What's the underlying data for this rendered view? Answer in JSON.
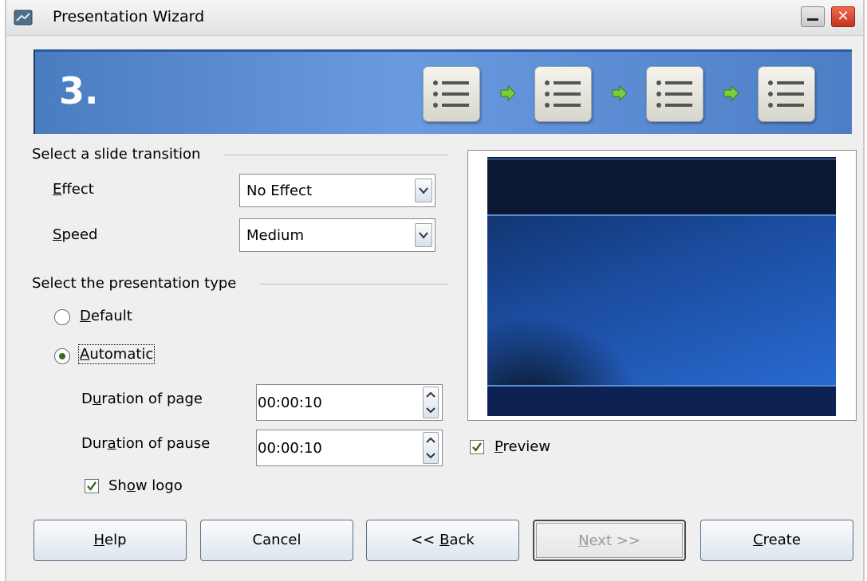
{
  "window": {
    "title": "Presentation Wizard",
    "close_glyph": "✕"
  },
  "banner": {
    "step": "3.",
    "accent_color": "#5b8fd6",
    "steps": [
      "list-icon",
      "list-icon",
      "list-icon",
      "list-icon"
    ]
  },
  "transition": {
    "section_label": "Select a slide transition",
    "effect": {
      "label_pre": "",
      "label_mnemonic": "E",
      "label_post": "ffect",
      "value": "No Effect"
    },
    "speed": {
      "label_pre": "",
      "label_mnemonic": "S",
      "label_post": "peed",
      "value": "Medium"
    }
  },
  "presentation_type": {
    "section_label": "Select the presentation type",
    "default": {
      "label_mnemonic": "D",
      "label_post": "efault",
      "selected": false
    },
    "automatic": {
      "label_mnemonic": "A",
      "label_post": "utomatic",
      "selected": true
    },
    "duration_page": {
      "label_pre": "D",
      "label_mnemonic": "u",
      "label_post": "ration of page",
      "value": "00:00:10"
    },
    "duration_pause": {
      "label_pre": "Dur",
      "label_mnemonic": "a",
      "label_post": "tion of pause",
      "value": "00:00:10"
    },
    "show_logo": {
      "label_pre": "Sh",
      "label_mnemonic": "o",
      "label_post": "w logo",
      "checked": true
    }
  },
  "preview": {
    "label_mnemonic": "P",
    "label_post": "review",
    "checked": true
  },
  "buttons": {
    "help": {
      "mnemonic": "H",
      "post": "elp"
    },
    "cancel": {
      "label": "Cancel"
    },
    "back": {
      "pre": "<< ",
      "mnemonic": "B",
      "post": "ack"
    },
    "next": {
      "mnemonic": "N",
      "post": "ext >>",
      "disabled": true
    },
    "create": {
      "mnemonic": "C",
      "post": "reate"
    }
  }
}
